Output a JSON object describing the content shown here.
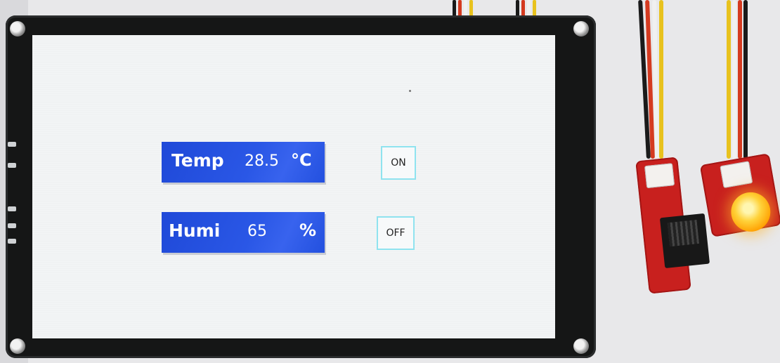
{
  "screen": {
    "temperature": {
      "label": "Temp",
      "value": "28.5",
      "unit": "°C"
    },
    "humidity": {
      "label": "Humi",
      "value": "65",
      "unit": "%"
    },
    "buttons": {
      "on_label": "ON",
      "off_label": "OFF"
    }
  },
  "colors": {
    "readout_bg": "#2352e3",
    "button_border": "#8fe3ef",
    "screen_bg": "#f2f4f5",
    "bezel": "#151616",
    "board_red": "#c8201e",
    "led_glow": "#ffb000"
  },
  "icons": [
    "screw-icon",
    "led-light-icon",
    "temperature-humidity-sensor-icon"
  ]
}
